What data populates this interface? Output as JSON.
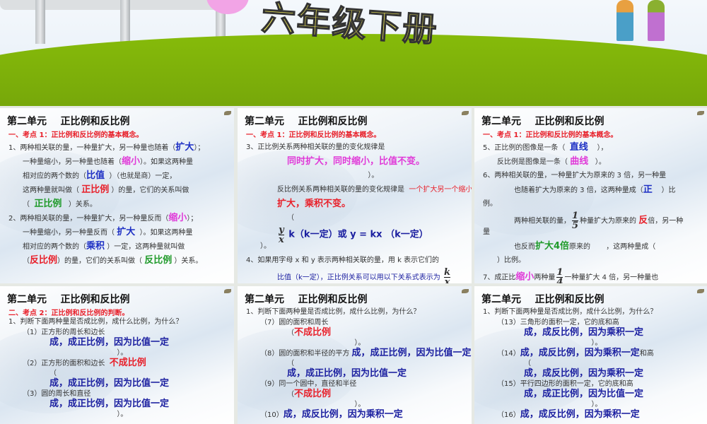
{
  "banner": {
    "title": "六年级下册"
  },
  "slides": [
    {
      "title": "第二单元    正比例和反比例",
      "subtitle": "一、考点 1：正比例和反比例的基本概念。",
      "lines": [
        {
          "c": "",
          "s": [
            {
              "t": "1、两种相关联的量，一种量扩大，另一种量也随着（"
            },
            {
              "t": "扩大",
              "k": "a blue"
            },
            {
              "t": "）；"
            }
          ]
        },
        {
          "c": "ind",
          "s": [
            {
              "t": "一种量缩小，另一种量也随着（"
            },
            {
              "t": "缩小",
              "k": "a pink"
            },
            {
              "t": "）。如果这两种量"
            }
          ]
        },
        {
          "c": "ind",
          "s": [
            {
              "t": "相对应的两个数的（"
            },
            {
              "t": "比值",
              "k": "a blue"
            },
            {
              "t": "  ）（也就是商）一定，"
            }
          ]
        },
        {
          "c": "ind",
          "s": [
            {
              "t": "这两种量就叫做（ "
            },
            {
              "t": "正比例",
              "k": "a red"
            },
            {
              "t": " ）的量，它们的关系叫做"
            }
          ]
        },
        {
          "c": "ind",
          "s": [
            {
              "t": "（  "
            },
            {
              "t": "正比例",
              "k": "a green"
            },
            {
              "t": "   ）关系。"
            }
          ]
        },
        {
          "c": "",
          "s": [
            {
              "t": "2、两种相关联的量，一种量扩大，另一种量反而（"
            },
            {
              "t": "缩小",
              "k": "a pink"
            },
            {
              "t": "）；"
            }
          ]
        },
        {
          "c": "ind",
          "s": [
            {
              "t": "一种量缩小，另一种量反而（ "
            },
            {
              "t": "扩大",
              "k": "a blue"
            },
            {
              "t": "  ）。如果这两种量"
            }
          ]
        },
        {
          "c": "ind",
          "s": [
            {
              "t": "相对应的两个数的（"
            },
            {
              "t": "乘积",
              "k": "a blue"
            },
            {
              "t": " ）一定，这两种量就叫做"
            }
          ]
        },
        {
          "c": "ind",
          "s": [
            {
              "t": "（"
            },
            {
              "t": "反比例",
              "k": "a red"
            },
            {
              "t": "）的量，它们的关系叫做（ "
            },
            {
              "t": "反比例",
              "k": "a green"
            },
            {
              "t": " ）关系。"
            }
          ]
        }
      ]
    },
    {
      "title": "第二单元    正比例和反比例",
      "subtitle": "一、考点 1：正比例和反比例的基本概念。",
      "lines": [
        {
          "c": "",
          "s": [
            {
              "t": "3、正比例关系两种相关联的量的变化规律是"
            }
          ]
        },
        {
          "c": "ind2",
          "s": [
            {
              "t": "同时扩大，同时缩小，比值不变。",
              "k": "a pink"
            }
          ]
        },
        {
          "c": "ind2",
          "s": [
            {
              "t": "                                    ）。"
            }
          ]
        },
        {
          "c": "ind3",
          "s": [
            {
              "t": "反比例关系两种相关联的量的变化规律是  "
            },
            {
              "t": "一个扩大另一个缩小，一个缩小另一个",
              "k": "red"
            }
          ]
        },
        {
          "c": "ind3",
          "s": [
            {
              "t": "扩大，乘积不变。",
              "k": "a red"
            }
          ]
        },
        {
          "c": "ind2",
          "s": [
            {
              "t": "（"
            }
          ]
        },
        {
          "c": "ind3",
          "s": [
            {
              "f": [
                "y",
                "x"
              ]
            },
            {
              "t": " k（k一定）或 y = kx （k一定）",
              "k": "a navy"
            }
          ]
        },
        {
          "c": "ind",
          "s": [
            {
              "t": "）。"
            }
          ]
        },
        {
          "c": "",
          "s": [
            {
              "t": "4、如果用字母 x 和 y 表示两种相关联的量，用 k 表示它们的"
            }
          ]
        },
        {
          "c": "ind3",
          "s": [
            {
              "t": "比值（k一定），正比例关系可以用以下关系式表示为 ",
              "k": "navy"
            },
            {
              "f": [
                "k",
                "x"
              ]
            }
          ]
        }
      ]
    },
    {
      "title": "第二单元    正比例和反比例",
      "subtitle": "一、考点 1：正比例和反比例的基本概念。",
      "lines": [
        {
          "c": "",
          "s": [
            {
              "t": "5、正比例的图像是一条（  "
            },
            {
              "t": "直线",
              "k": "a blue"
            },
            {
              "t": "    ），"
            }
          ]
        },
        {
          "c": "ind",
          "s": [
            {
              "t": "反比例是图像是一条（ "
            },
            {
              "t": "曲线",
              "k": "a pink"
            },
            {
              "t": "   ）。"
            }
          ]
        },
        {
          "c": "",
          "s": [
            {
              "t": "6、两种相关联的量，一种量扩大为原来的 3 倍，另一种量"
            }
          ]
        },
        {
          "c": "ind3",
          "s": [
            {
              "t": "也随着扩大为原来的 3 倍，这两种量成（"
            },
            {
              "t": "正",
              "k": "a blue"
            },
            {
              "t": "    ）比"
            }
          ]
        },
        {
          "c": "",
          "s": [
            {
              "t": "例。"
            }
          ]
        },
        {
          "c": "ind3",
          "s": [
            {
              "t": "两种相关联的量，"
            },
            {
              "f": [
                "1",
                "5"
              ]
            },
            {
              "t": "种量扩大为原来的 "
            },
            {
              "t": "反",
              "k": "a red"
            },
            {
              "t": "倍，另一种"
            }
          ]
        },
        {
          "c": "",
          "s": [
            {
              "t": "量"
            }
          ]
        },
        {
          "c": "ind3",
          "s": [
            {
              "t": "也反而"
            },
            {
              "t": "扩大4倍",
              "k": "a green"
            },
            {
              "t": "原来的       ，这两种量成（"
            }
          ]
        },
        {
          "c": "ind",
          "s": [
            {
              "t": "）比例。"
            }
          ]
        },
        {
          "c": "",
          "s": [
            {
              "t": "7、成正比"
            },
            {
              "t": "缩小",
              "k": "a pink"
            },
            {
              "t": "两种量"
            },
            {
              "f": [
                "1",
                "4"
              ]
            },
            {
              "t": "一种量扩大 4 倍，另一种量也"
            }
          ]
        }
      ]
    },
    {
      "title": "第二单元    正比例和反比例",
      "subtitle": "二、考点 2：正比例和反比例的判断。",
      "dense": true,
      "lines": [
        {
          "c": "",
          "s": [
            {
              "t": "1、判断下面两种量是否成比例，成什么比例，为什么？"
            }
          ]
        },
        {
          "c": "ind",
          "s": [
            {
              "t": "（1）正方形的周长和边长"
            }
          ]
        },
        {
          "c": "ind2",
          "s": [
            {
              "t": "成，成正比例，因为比值一定",
              "k": "a navy"
            }
          ]
        },
        {
          "c": "ind2",
          "s": [
            {
              "t": "                              ）。"
            }
          ]
        },
        {
          "c": "ind",
          "s": [
            {
              "t": "（2）正方形的面积和边长  "
            },
            {
              "t": "不成比例",
              "k": "a red"
            }
          ]
        },
        {
          "c": "ind2",
          "s": [
            {
              "t": "（"
            }
          ]
        },
        {
          "c": "ind2",
          "s": [
            {
              "t": "成，成正比例，因为比值一定",
              "k": "a navy"
            }
          ]
        },
        {
          "c": "ind",
          "s": [
            {
              "t": "（3）圆的周长和直径"
            }
          ]
        },
        {
          "c": "ind2",
          "s": [
            {
              "t": "成，成正比例，因为比值一定",
              "k": "a navy"
            }
          ]
        },
        {
          "c": "ind2",
          "s": [
            {
              "t": "                              ）。"
            }
          ]
        }
      ]
    },
    {
      "title": "第二单元    正比例和反比例",
      "subtitle": "",
      "dense": true,
      "lines": [
        {
          "c": "",
          "s": [
            {
              "t": "1、判断下面两种量是否成比例，成什么比例，为什么？"
            }
          ]
        },
        {
          "c": "ind",
          "s": [
            {
              "t": "（7）圆的面积和周长"
            }
          ]
        },
        {
          "c": "ind2",
          "s": [
            {
              "t": "（"
            },
            {
              "t": "不成比例",
              "k": "a red"
            }
          ]
        },
        {
          "c": "ind2",
          "s": [
            {
              "t": "                              ）。"
            }
          ]
        },
        {
          "c": "ind",
          "s": [
            {
              "t": "（8）圆的面积和半径的平方 "
            },
            {
              "t": "成，成正比例，因为比值一定",
              "k": "a navy"
            }
          ]
        },
        {
          "c": "ind2",
          "s": [
            {
              "t": "（"
            }
          ]
        },
        {
          "c": "ind2",
          "s": [
            {
              "t": "成，成正比例，因为比值一定",
              "k": "a navy"
            }
          ]
        },
        {
          "c": "ind",
          "s": [
            {
              "t": "（9）同一个圆中，直径和半径"
            }
          ]
        },
        {
          "c": "ind2",
          "s": [
            {
              "t": "（"
            },
            {
              "t": "不成比例",
              "k": "a red"
            }
          ]
        },
        {
          "c": "ind2",
          "s": [
            {
              "t": "                              ）。"
            }
          ]
        },
        {
          "c": "ind",
          "s": [
            {
              "t": "（10）"
            },
            {
              "t": "成，成反比例，因为乘积一定",
              "k": "a navy"
            }
          ]
        }
      ]
    },
    {
      "title": "第二单元    正比例和反比例",
      "subtitle": "",
      "dense": true,
      "lines": [
        {
          "c": "",
          "s": [
            {
              "t": "1、判断下面两种量是否成比例，成什么比例，为什么？"
            }
          ]
        },
        {
          "c": "ind",
          "s": [
            {
              "t": "（13）三角形的面积一定，它的底和高"
            }
          ]
        },
        {
          "c": "ind2",
          "s": [
            {
              "t": "成，成反比例，因为乘积一定",
              "k": "a navy"
            }
          ]
        },
        {
          "c": "ind2",
          "s": [
            {
              "t": "                              ）。"
            }
          ]
        },
        {
          "c": "ind",
          "s": [
            {
              "t": "（14）"
            },
            {
              "t": "成，成反比例，因为乘积一定",
              "k": "a navy"
            },
            {
              "t": "和高"
            }
          ]
        },
        {
          "c": "ind2",
          "s": [
            {
              "t": "（"
            }
          ]
        },
        {
          "c": "ind2",
          "s": [
            {
              "t": "成，成反比例，因为乘积一定",
              "k": "a navy"
            }
          ]
        },
        {
          "c": "ind",
          "s": [
            {
              "t": "（15）平行四边形的面积一定，它的底和高"
            }
          ]
        },
        {
          "c": "ind2",
          "s": [
            {
              "t": "成，成正比例，因为比值一定",
              "k": "a navy"
            }
          ]
        },
        {
          "c": "ind2",
          "s": [
            {
              "t": "                              ）。"
            }
          ]
        },
        {
          "c": "ind",
          "s": [
            {
              "t": "（16）"
            },
            {
              "t": "成，成反比例，因为乘积一定",
              "k": "a navy"
            }
          ]
        }
      ]
    }
  ]
}
